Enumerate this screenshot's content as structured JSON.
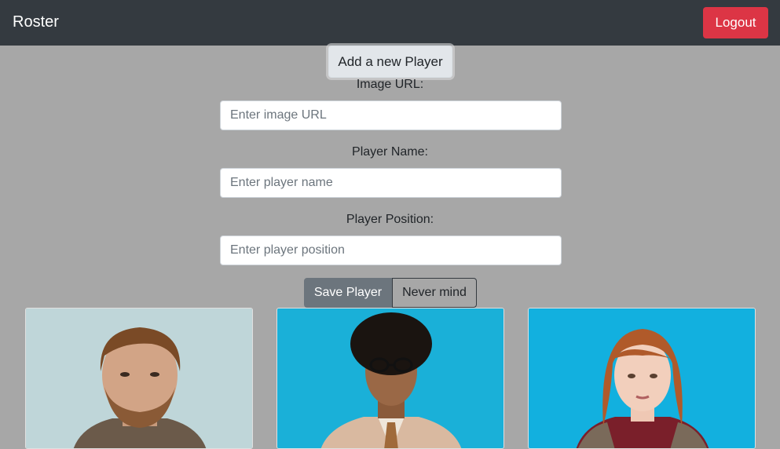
{
  "navbar": {
    "brand": "Roster",
    "logout_label": "Logout"
  },
  "add_player_label": "Add a new Player",
  "form": {
    "image_url_label": "Image URL:",
    "image_url_placeholder": "Enter image URL",
    "player_name_label": "Player Name:",
    "player_name_placeholder": "Enter player name",
    "player_position_label": "Player Position:",
    "player_position_placeholder": "Enter player position",
    "save_label": "Save Player",
    "cancel_label": "Never mind"
  },
  "colors": {
    "navbar_bg": "#343a40",
    "logout_bg": "#dc3545",
    "page_bg": "#a7a7a7",
    "save_bg": "#6c757d"
  }
}
